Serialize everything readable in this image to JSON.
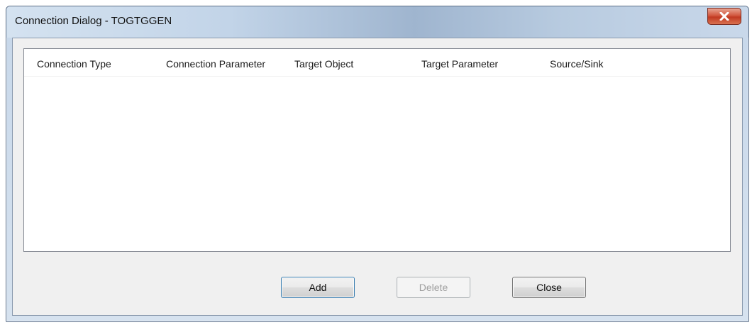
{
  "window": {
    "title": "Connection Dialog - TOGTGGEN",
    "close_glyph": "x"
  },
  "list": {
    "columns": [
      "Connection Type",
      "Connection Parameter",
      "Target Object",
      "Target Parameter",
      "Source/Sink"
    ],
    "rows": []
  },
  "buttons": {
    "add_label": "Add",
    "delete_label": "Delete",
    "close_label": "Close"
  },
  "colors": {
    "close_button_red": "#c13a22",
    "title_bar_blue": "#9fb5cf"
  },
  "icons": {
    "close": "close-icon"
  }
}
